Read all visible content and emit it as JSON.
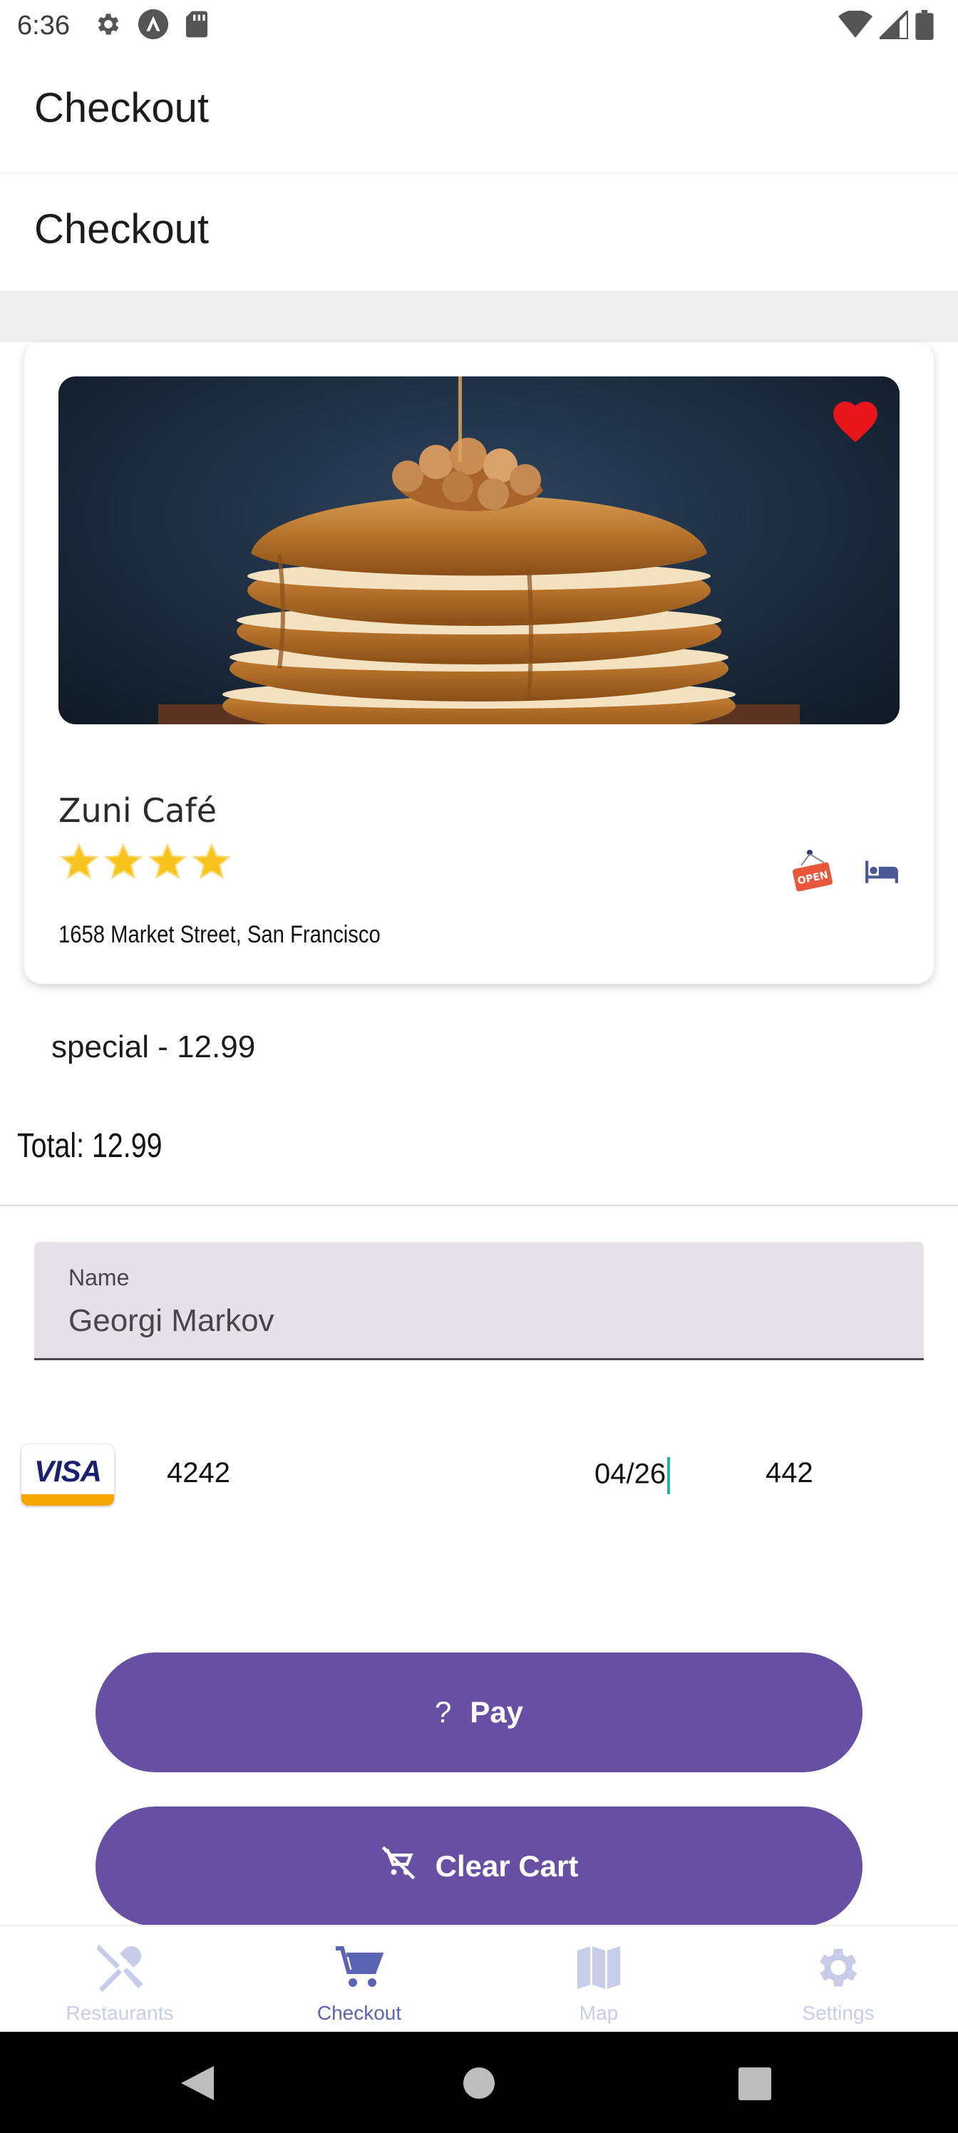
{
  "status_bar": {
    "time": "6:36",
    "icons_left": [
      "settings-icon",
      "a-circle-icon",
      "sd-card-icon"
    ],
    "icons_right": [
      "wifi-icon",
      "signal-icon",
      "battery-icon"
    ]
  },
  "app_bar": {
    "title": "Checkout"
  },
  "page": {
    "title": "Checkout"
  },
  "restaurant": {
    "name": "Zuni Café",
    "rating": 4,
    "rating_max": 4,
    "address": "1658 Market Street, San Francisco",
    "favorite": true,
    "status_badge": "OPEN",
    "icons": [
      "open-sign-icon",
      "bed-icon"
    ]
  },
  "cart": {
    "items": [
      {
        "label": "special - 12.99"
      }
    ],
    "total": "Total: 12.99"
  },
  "form": {
    "name_label": "Name",
    "name_value": "Georgi Markov"
  },
  "payment_card": {
    "brand": "VISA",
    "number": "4242",
    "expiry": "04/26",
    "cvc": "442"
  },
  "buttons": {
    "pay_label": "Pay",
    "pay_icon": "?",
    "clear_label": "Clear Cart"
  },
  "bottom_nav": {
    "items": [
      {
        "label": "Restaurants",
        "icon": "utensils-icon",
        "active": false
      },
      {
        "label": "Checkout",
        "icon": "cart-icon",
        "active": true
      },
      {
        "label": "Map",
        "icon": "map-icon",
        "active": false
      },
      {
        "label": "Settings",
        "icon": "gear-icon",
        "active": false
      }
    ]
  },
  "colors": {
    "primary": "#6750a4",
    "nav_active": "#5a64b3",
    "nav_inactive": "#c7cde8",
    "heart": "#e8151b",
    "star": "#f7c31c"
  }
}
